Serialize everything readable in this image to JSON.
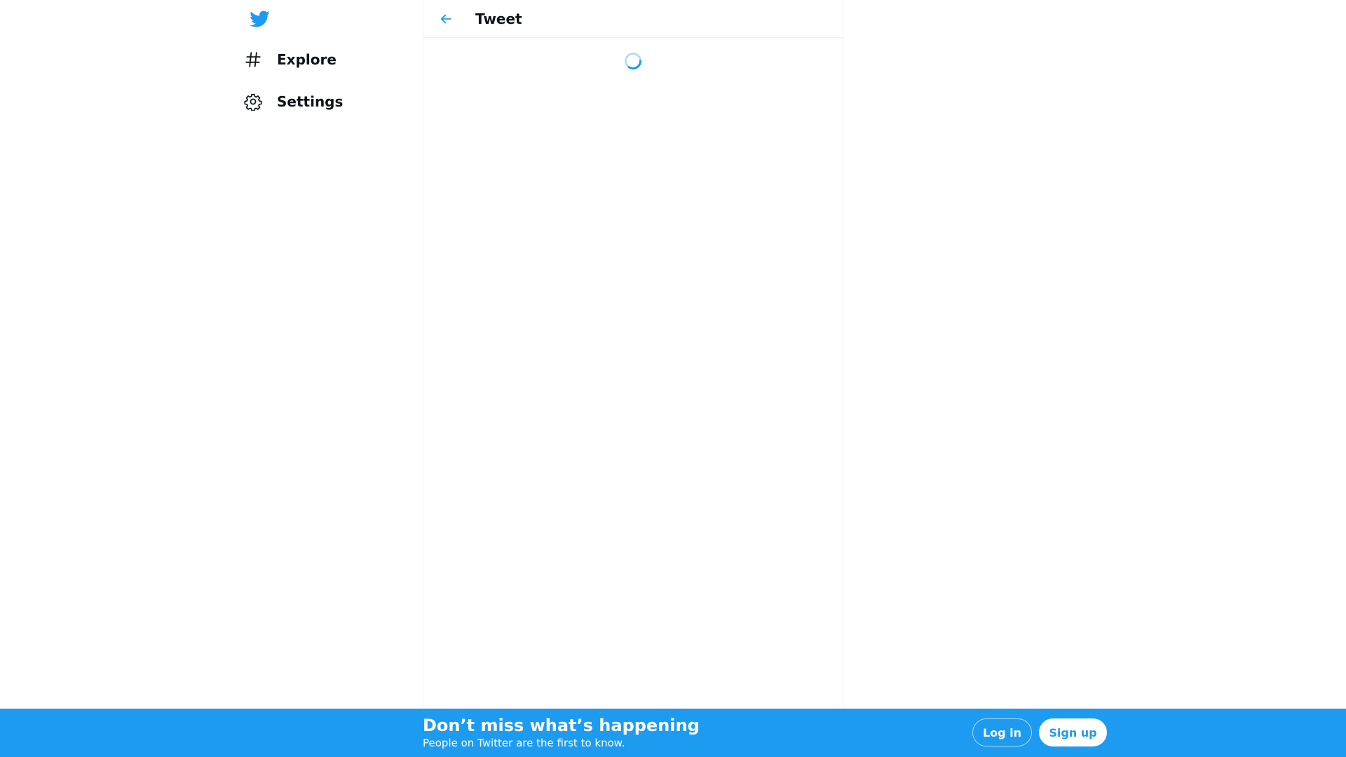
{
  "colors": {
    "brand": "#1d9bf0",
    "text": "#0f1419",
    "border": "#eff3f4",
    "banner_text": "#ffffff"
  },
  "left_nav": {
    "logo_icon": "twitter-bird-icon",
    "items": [
      {
        "label": "Explore",
        "icon": "hashtag-icon"
      },
      {
        "label": "Settings",
        "icon": "gear-icon"
      }
    ]
  },
  "main": {
    "back_icon": "back-arrow-icon",
    "header_title": "Tweet",
    "loading_icon": "loading-spinner-icon"
  },
  "bottom_banner": {
    "title": "Don’t miss what’s happening",
    "subtitle": "People on Twitter are the first to know.",
    "login_label": "Log in",
    "signup_label": "Sign up"
  }
}
